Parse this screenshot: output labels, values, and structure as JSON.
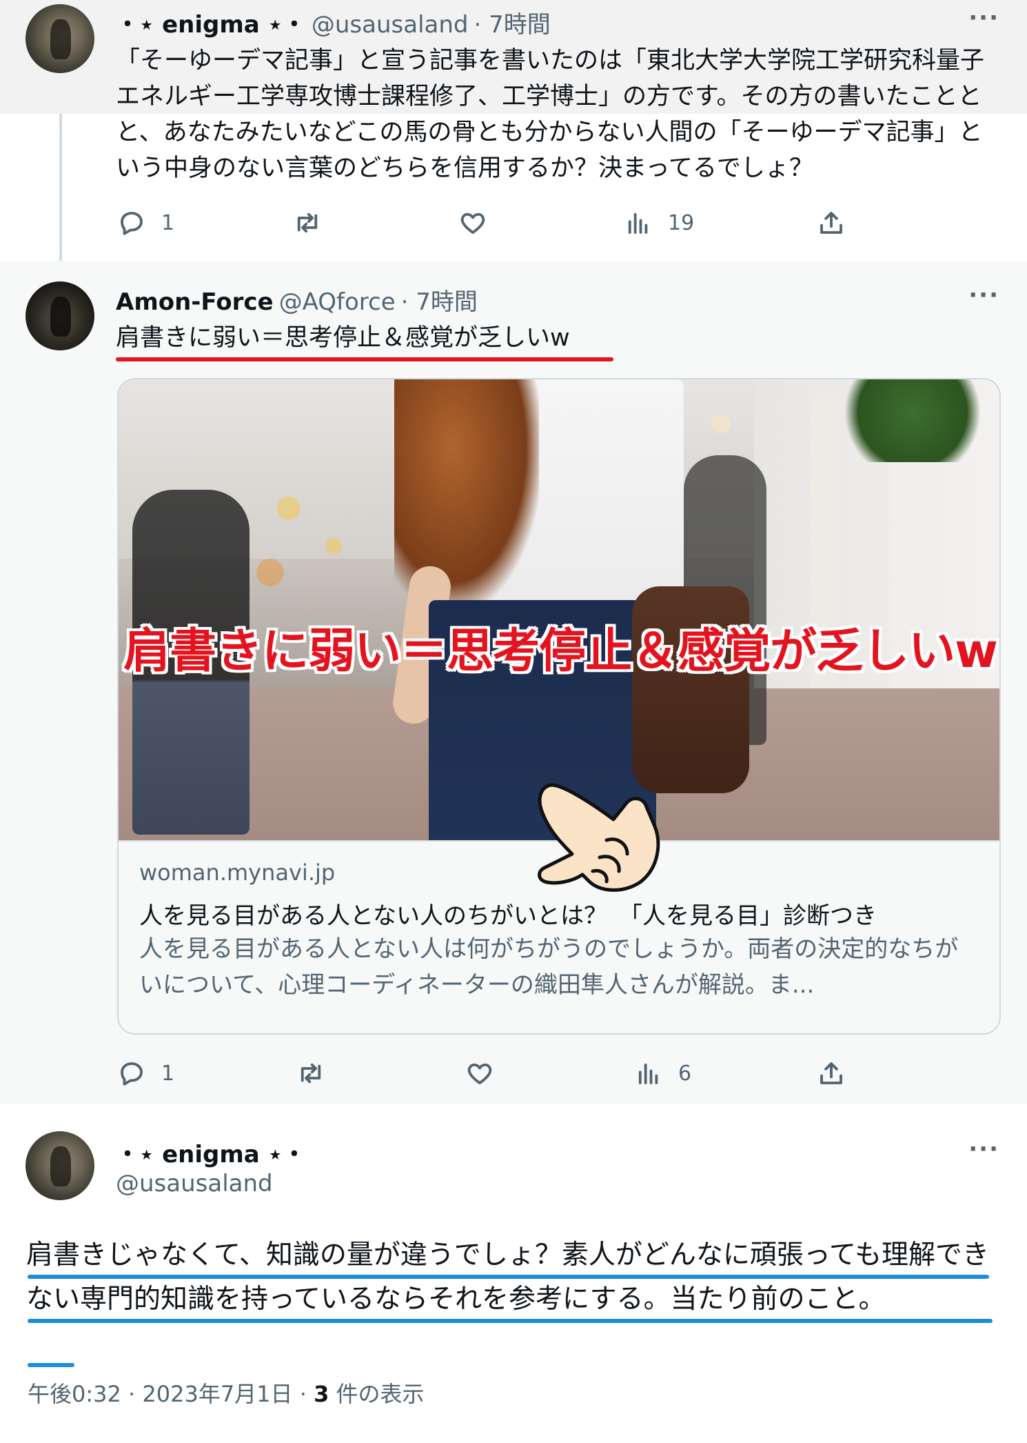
{
  "tweets": [
    {
      "name": "・⋆ enigma ⋆・",
      "handle": "@usausaland",
      "time": "· 7時間",
      "text": "「そーゆーデマ記事」と宣う記事を書いたのは「東北大学大学院工学研究科量子エネルギー工学専攻博士課程修了、工学博士」の方です。その方の書いたこととと、あなたみたいなどこの馬の骨とも分からない人間の「そーゆーデマ記事」という中身のない言葉のどちらを信用するか？決まってるでしょ？",
      "more": "···",
      "replies": "1",
      "retweets": "",
      "likes": "",
      "views": "19"
    },
    {
      "name": "Amon-Force",
      "handle": "@AQforce",
      "time": "· 7時間",
      "text": "肩書きに弱い＝思考停止＆感覚が乏しいw",
      "more": "···",
      "card": {
        "overlay": "肩書きに弱い＝思考停止＆感覚が乏しいw",
        "domain": "woman.mynavi.jp",
        "title": "人を見る目がある人とない人のちがいとは？　「人を見る目」診断つき",
        "description": "人を見る目がある人とない人は何がちがうのでしょうか。両者の決定的なちがいについて、心理コーディネーターの織田隼人さんが解説。ま..."
      },
      "replies": "1",
      "retweets": "",
      "likes": "",
      "views": "6"
    },
    {
      "name": "・⋆ enigma ⋆・",
      "handle": "@usausaland",
      "more": "···",
      "text": "肩書きじゃなくて、知識の量が違うでしょ？素人がどんなに頑張っても理解できない専門的知識を持っているならそれを参考にする。当たり前のこと。",
      "meta_time": "午後0:32 · 2023年7月1日 · ",
      "meta_views": "3",
      "meta_suffix": " 件の表示"
    }
  ],
  "colors": {
    "red_underline": "#e3141f",
    "blue_underline": "#1a8fd8",
    "secondary_text": "#536471"
  },
  "icons": [
    "reply-icon",
    "retweet-icon",
    "like-icon",
    "views-icon",
    "share-icon",
    "pointing-hand-icon",
    "more-icon"
  ]
}
